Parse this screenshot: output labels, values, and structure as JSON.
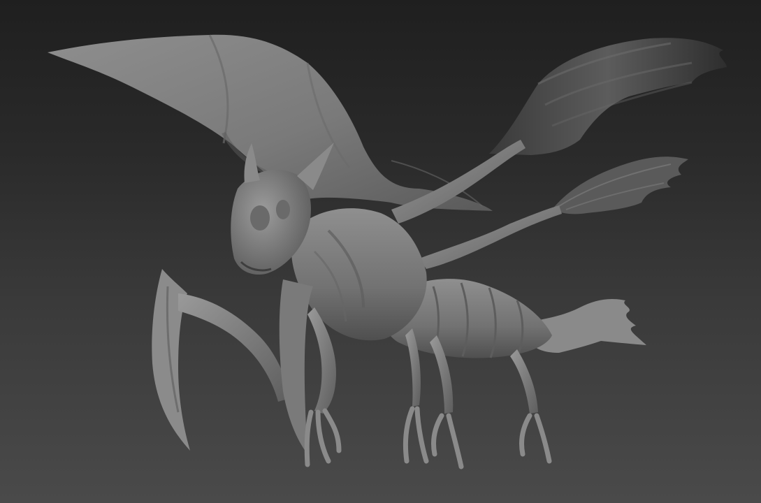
{
  "scene": {
    "subject_icon": "winged-insectoid-creature-sculpt",
    "colors": {
      "background_top": "#1f1f1f",
      "background_bottom": "#4a4a4a",
      "clay_light": "#9a9a9a",
      "clay_mid": "#7d7d7d",
      "clay_dark": "#4e4e4e",
      "clay_shadow": "#2e2e2e"
    }
  }
}
